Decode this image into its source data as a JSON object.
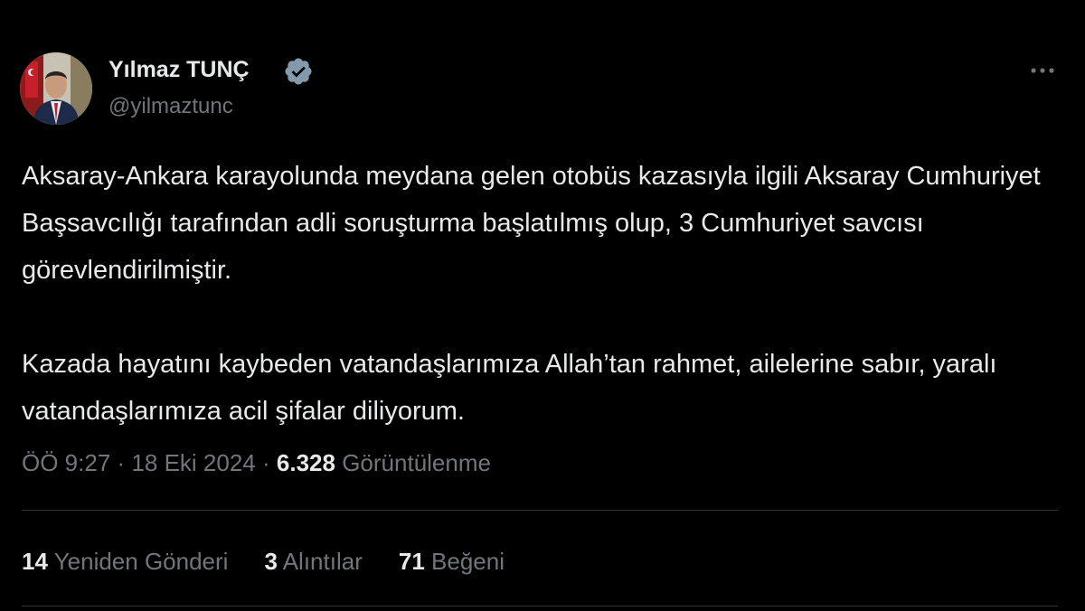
{
  "author": {
    "name": "Yılmaz TUNÇ",
    "handle": "@yilmaztunc",
    "verified_icon": "verified-badge-icon",
    "badge_color": "#829aab"
  },
  "more_icon": "more-horizontal-icon",
  "tweet": {
    "paragraphs": [
      "Aksaray-Ankara karayolunda meydana gelen otobüs kazasıyla ilgili Aksaray Cumhuriyet Başsavcılığı tarafından adli soruşturma başlatılmış olup, 3 Cumhuriyet savcısı görevlendirilmiştir.",
      "Kazada hayatını kaybeden vatandaşlarımıza Allah’tan rahmet, ailelerine sabır, yaralı vatandaşlarımıza acil şifalar diliyorum."
    ]
  },
  "meta": {
    "time": "ÖÖ 9:27",
    "separator": "·",
    "date": "18 Eki 2024",
    "views_count": "6.328",
    "views_label": "Görüntülenme"
  },
  "stats": {
    "reposts_count": "14",
    "reposts_label": "Yeniden Gönderi",
    "quotes_count": "3",
    "quotes_label": "Alıntılar",
    "likes_count": "71",
    "likes_label": "Beğeni"
  },
  "colors": {
    "background": "#000000",
    "primary_text": "#e7e9ea",
    "secondary_text": "#71767b",
    "divider": "#2f3336"
  }
}
